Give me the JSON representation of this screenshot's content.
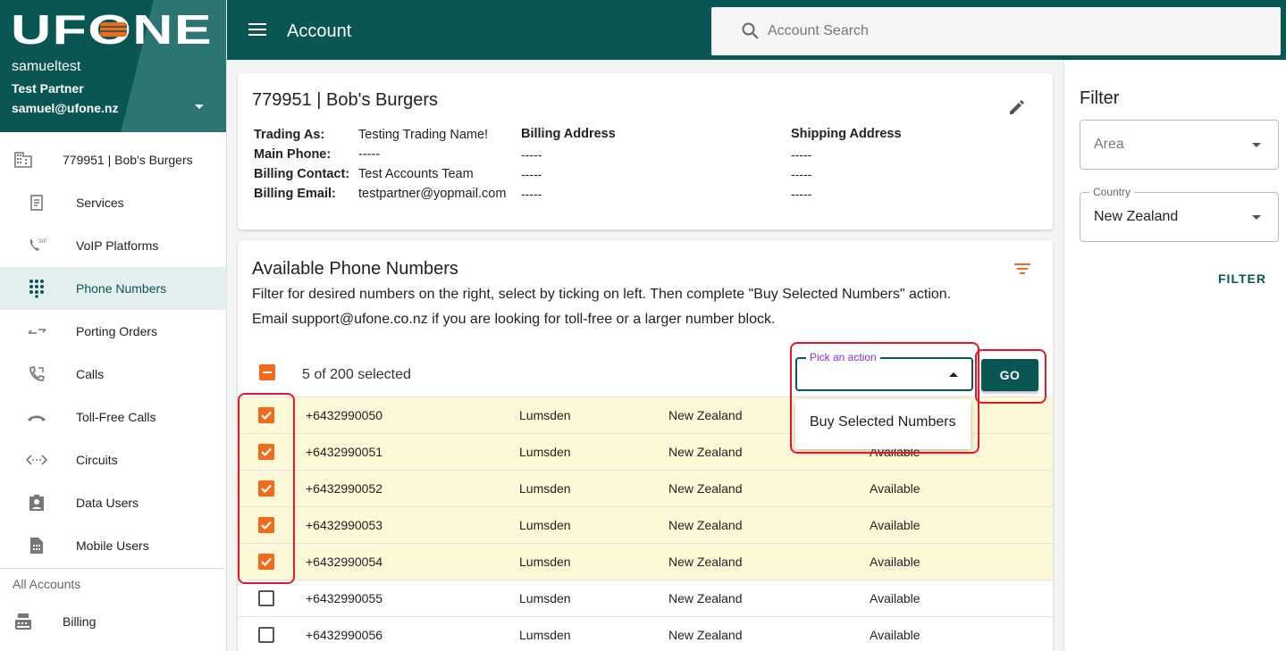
{
  "brand": {
    "logo_text": "UFONE",
    "username": "samueltest",
    "partner": "Test Partner",
    "email": "samuel@ufone.nz"
  },
  "sidebar": {
    "account_item": "779951 | Bob's Burgers",
    "items": [
      {
        "label": "Services",
        "icon": "receipt-icon"
      },
      {
        "label": "VoIP Platforms",
        "icon": "sip-phone-icon"
      },
      {
        "label": "Phone Numbers",
        "icon": "dialpad-icon"
      },
      {
        "label": "Porting Orders",
        "icon": "swap-arrows-icon"
      },
      {
        "label": "Calls",
        "icon": "phone-forward-icon"
      },
      {
        "label": "Toll-Free Calls",
        "icon": "call-end-icon"
      },
      {
        "label": "Circuits",
        "icon": "settings-ethernet-icon"
      },
      {
        "label": "Data Users",
        "icon": "assignment-ind-icon"
      },
      {
        "label": "Mobile Users",
        "icon": "sim-card-icon"
      }
    ],
    "active_index": 2,
    "section_label": "All Accounts",
    "billing_label": "Billing"
  },
  "topbar": {
    "title": "Account",
    "search_placeholder": "Account Search"
  },
  "account": {
    "name": "779951 | Bob's Burgers",
    "trading_as_label": "Trading As:",
    "trading_as": "Testing Trading Name!",
    "main_phone_label": "Main Phone:",
    "main_phone": "-----",
    "billing_contact_label": "Billing Contact:",
    "billing_contact": "Test Accounts Team",
    "billing_email_label": "Billing Email:",
    "billing_email": "testpartner@yopmail.com",
    "billing_address_label": "Billing Address",
    "billing_address_lines": [
      "-----",
      "-----",
      "-----"
    ],
    "shipping_address_label": "Shipping Address",
    "shipping_address_lines": [
      "-----",
      "-----",
      "-----"
    ]
  },
  "numbers": {
    "title": "Available Phone Numbers",
    "desc1": "Filter for desired numbers on the right, select by ticking on left. Then complete \"Buy Selected Numbers\" action.",
    "desc2": "Email support@ufone.co.nz if you are looking for toll-free or a larger number block.",
    "selected_text": "5 of 200 selected",
    "action_label": "Pick an action",
    "action_option": "Buy Selected Numbers",
    "go_label": "GO",
    "rows": [
      {
        "number": "+6432990050",
        "area": "Lumsden",
        "country": "New Zealand",
        "status": "",
        "checked": true
      },
      {
        "number": "+6432990051",
        "area": "Lumsden",
        "country": "New Zealand",
        "status": "Available",
        "checked": true
      },
      {
        "number": "+6432990052",
        "area": "Lumsden",
        "country": "New Zealand",
        "status": "Available",
        "checked": true
      },
      {
        "number": "+6432990053",
        "area": "Lumsden",
        "country": "New Zealand",
        "status": "Available",
        "checked": true
      },
      {
        "number": "+6432990054",
        "area": "Lumsden",
        "country": "New Zealand",
        "status": "Available",
        "checked": true
      },
      {
        "number": "+6432990055",
        "area": "Lumsden",
        "country": "New Zealand",
        "status": "Available",
        "checked": false
      },
      {
        "number": "+6432990056",
        "area": "Lumsden",
        "country": "New Zealand",
        "status": "Available",
        "checked": false
      }
    ]
  },
  "filter": {
    "title": "Filter",
    "area_placeholder": "Area",
    "country_label": "Country",
    "country_value": "New Zealand",
    "button_label": "FILTER"
  },
  "colors": {
    "primary": "#0a5653",
    "accent": "#f26a1b",
    "selected_row": "#fdf8d7",
    "highlight": "#e3192a"
  }
}
